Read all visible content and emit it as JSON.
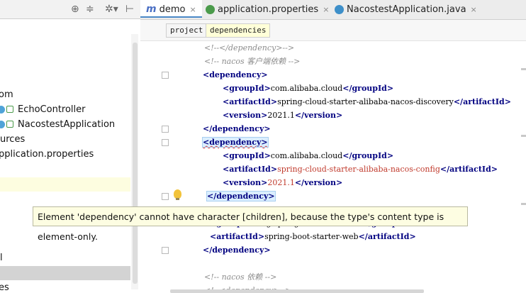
{
  "project_panel": {
    "toolbar_icons": [
      "target-icon",
      "collapse-icon",
      "gear-icon",
      "hide-icon"
    ],
    "tree": [
      {
        "label": "om",
        "type": "folder"
      },
      {
        "label": "EchoController",
        "type": "class"
      },
      {
        "label": "NacostestApplication",
        "type": "class"
      },
      {
        "label": "urces",
        "type": "folder"
      },
      {
        "label": "pplication.properties",
        "type": "file"
      },
      {
        "label": "l",
        "type": "file"
      },
      {
        "label": "es",
        "type": "folder"
      }
    ]
  },
  "tabs": [
    {
      "prefix": "m",
      "label": "demo",
      "active": true
    },
    {
      "label": "application.properties",
      "active": false
    },
    {
      "label": "NacostestApplication.java",
      "active": false
    }
  ],
  "close_glyph": "×",
  "breadcrumbs": [
    "project",
    "dependencies"
  ],
  "code": [
    {
      "parts": [
        {
          "t": "<!--</dependency>-->",
          "c": "cmt"
        }
      ]
    },
    {
      "parts": [
        {
          "t": "<!-- nacos 客户端依赖 -->",
          "c": "cmt"
        }
      ]
    },
    {
      "parts": [
        {
          "t": "<dependency>",
          "c": "tag"
        }
      ]
    },
    {
      "parts": [
        {
          "t": "<groupId>",
          "c": "tag"
        },
        {
          "t": "com.alibaba.cloud",
          "c": ""
        },
        {
          "t": "</groupId>",
          "c": "tag"
        }
      ]
    },
    {
      "parts": [
        {
          "t": "<artifactId>",
          "c": "tag"
        },
        {
          "t": "spring-cloud-starter-alibaba-nacos-discovery",
          "c": ""
        },
        {
          "t": "</artifactId>",
          "c": "tag"
        }
      ]
    },
    {
      "parts": [
        {
          "t": "<version>",
          "c": "tag"
        },
        {
          "t": "2021.1",
          "c": ""
        },
        {
          "t": "</version>",
          "c": "tag"
        }
      ]
    },
    {
      "parts": [
        {
          "t": "</dependency>",
          "c": "tag"
        }
      ]
    },
    {
      "parts": [
        {
          "t": "<dependency>",
          "c": "tag squig tagbox"
        }
      ]
    },
    {
      "parts": [
        {
          "t": "<groupId>",
          "c": "tag"
        },
        {
          "t": "com.alibaba.cloud",
          "c": ""
        },
        {
          "t": "</groupId>",
          "c": "tag"
        }
      ]
    },
    {
      "parts": [
        {
          "t": "<artifactId>",
          "c": "tag"
        },
        {
          "t": "spring-cloud-starter-alibaba-nacos-config",
          "c": "str"
        },
        {
          "t": "</artifactId>",
          "c": "tag"
        }
      ]
    },
    {
      "parts": [
        {
          "t": "<version>",
          "c": "tag"
        },
        {
          "t": "2021.1",
          "c": "str"
        },
        {
          "t": "</version>",
          "c": "tag"
        }
      ]
    },
    {
      "parts": [
        {
          "t": "</dependency>",
          "c": "tag tagbox"
        }
      ]
    },
    {
      "parts": []
    },
    {
      "parts": [
        {
          "t": "<groupId>",
          "c": "tag"
        },
        {
          "t": "org.springframework.boot",
          "c": ""
        },
        {
          "t": "</groupId>",
          "c": "tag"
        }
      ]
    },
    {
      "parts": [
        {
          "t": "<artifactId>",
          "c": "tag"
        },
        {
          "t": "spring-boot-starter-web",
          "c": ""
        },
        {
          "t": "</artifactId>",
          "c": "tag"
        }
      ]
    },
    {
      "parts": [
        {
          "t": "</dependency>",
          "c": "tag"
        }
      ]
    },
    {
      "parts": []
    },
    {
      "parts": [
        {
          "t": "<!-- nacos 依赖 -->",
          "c": "cmt"
        }
      ]
    },
    {
      "parts": [
        {
          "t": "<!--<dependency>-->",
          "c": "cmt"
        }
      ]
    }
  ],
  "tooltip": "Element 'dependency' cannot have character [children], because the type's content type is element-only.",
  "colors": {
    "accent": "#4a88c7",
    "tag": "#000080",
    "string": "#c0392b",
    "comment": "#8c8c8c",
    "tooltip_bg": "#fdfde2"
  }
}
